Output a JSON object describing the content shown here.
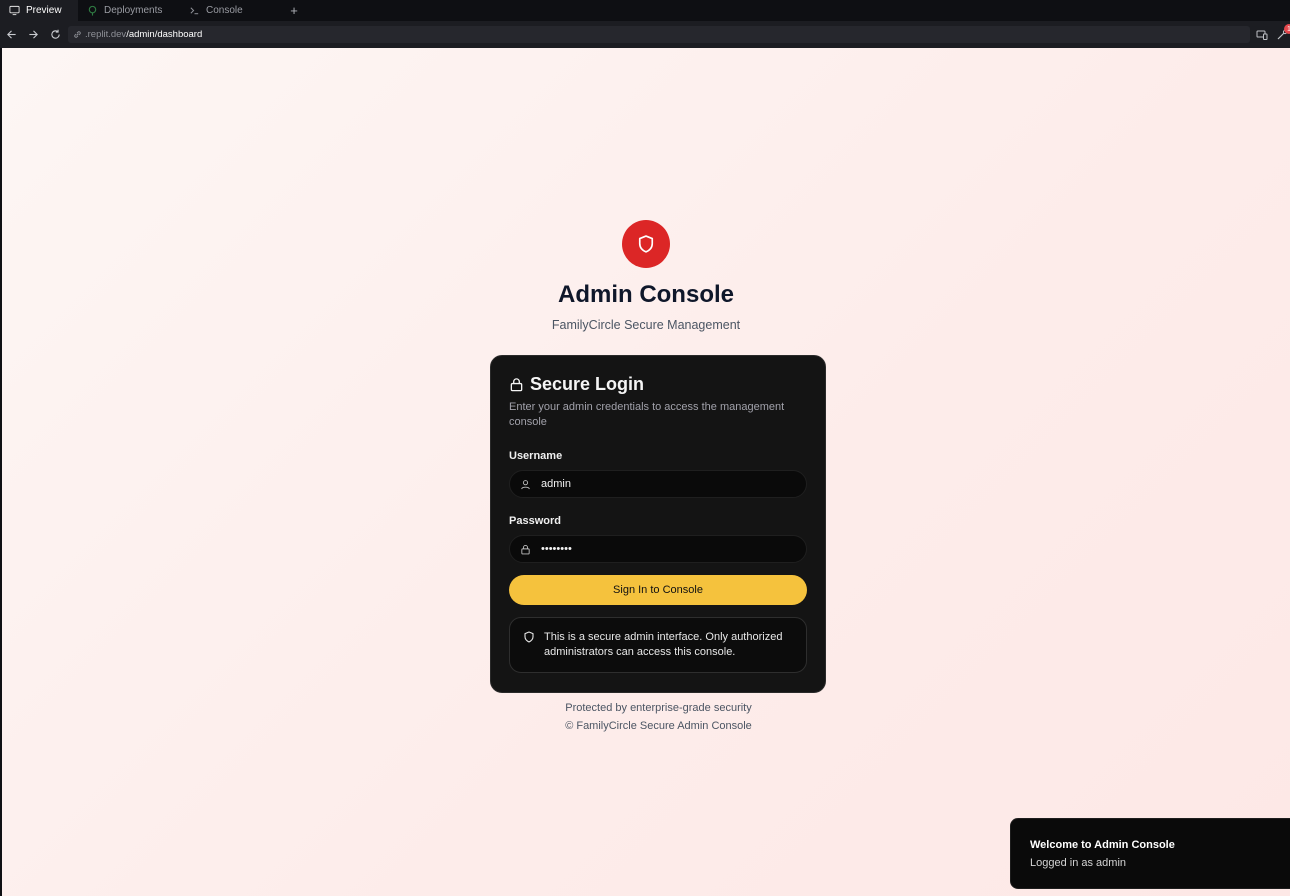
{
  "browser": {
    "tabs": [
      {
        "label": "Preview",
        "icon": "monitor-icon",
        "active": true
      },
      {
        "label": "Deployments",
        "icon": "deploy-icon",
        "active": false
      },
      {
        "label": "Console",
        "icon": "terminal-icon",
        "active": false
      }
    ],
    "new_tab_label": "+",
    "url_host": ".replit.dev",
    "url_path": "/admin/dashboard",
    "notification_count": "1"
  },
  "page": {
    "logo_icon": "shield-icon",
    "title": "Admin Console",
    "subtitle": "FamilyCircle Secure Management",
    "card": {
      "title": "Secure Login",
      "description": "Enter your admin credentials to access the management console",
      "username_label": "Username",
      "username_value": "admin",
      "password_label": "Password",
      "password_value": "••••••••",
      "submit_label": "Sign In to Console",
      "notice": "This is a secure admin interface. Only authorized administrators can access this console."
    },
    "footer": {
      "line1": "Protected by enterprise-grade security",
      "line2": "© FamilyCircle Secure Admin Console"
    },
    "toast": {
      "title": "Welcome to Admin Console",
      "description": "Logged in as admin"
    }
  },
  "colors": {
    "accent": "#dc2626",
    "button": "#f5c23d",
    "card_bg": "#141414",
    "page_bg": "#fdecea"
  }
}
